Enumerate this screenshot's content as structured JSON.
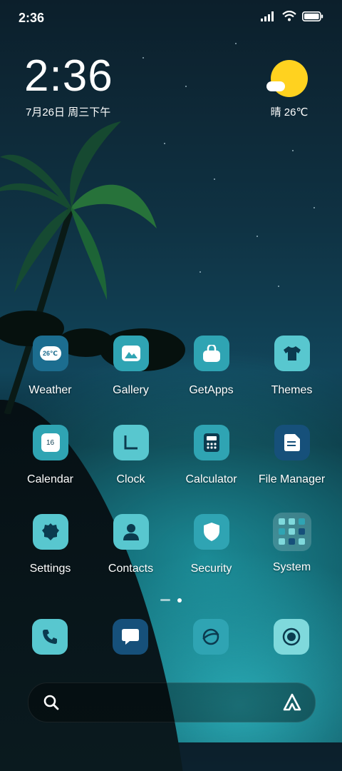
{
  "status_bar": {
    "time": "2:36",
    "signal_icon": "signal-bars-icon",
    "wifi_icon": "wifi-icon",
    "battery_icon": "battery-icon"
  },
  "clock_widget": {
    "time": "2:36",
    "date": "7月26日 周三下午"
  },
  "weather_widget": {
    "condition": "晴",
    "temperature": "26℃",
    "icon": "sun-icon",
    "summary": "晴 26℃"
  },
  "apps": [
    {
      "label": "Weather",
      "icon": "weather-icon",
      "icon_text": "26℃",
      "color": "#1c6d8f"
    },
    {
      "label": "Gallery",
      "icon": "gallery-icon",
      "color": "#2fa4b3"
    },
    {
      "label": "GetApps",
      "icon": "shopping-bag-icon",
      "color": "#2fa4b3"
    },
    {
      "label": "Themes",
      "icon": "tshirt-icon",
      "color": "#58c7cf"
    },
    {
      "label": "Calendar",
      "icon": "calendar-icon",
      "icon_text": "16",
      "color": "#2fa4b3"
    },
    {
      "label": "Clock",
      "icon": "clock-icon",
      "color": "#58c7cf"
    },
    {
      "label": "Calculator",
      "icon": "calculator-icon",
      "color": "#2fa4b3"
    },
    {
      "label": "File Manager",
      "icon": "file-manager-icon",
      "color": "#16507a"
    },
    {
      "label": "Settings",
      "icon": "settings-icon",
      "color": "#58c7cf"
    },
    {
      "label": "Contacts",
      "icon": "contacts-icon",
      "color": "#58c7cf"
    },
    {
      "label": "Security",
      "icon": "shield-icon",
      "color": "#2fa4b3"
    },
    {
      "label": "System",
      "icon": "folder-icon",
      "color": "rgba(255,255,255,0.18)"
    }
  ],
  "page_indicator": {
    "pages": 2,
    "current": 2
  },
  "dock": [
    {
      "name": "phone",
      "icon": "phone-icon",
      "color": "#58c7cf"
    },
    {
      "name": "messages",
      "icon": "message-icon",
      "color": "#16507a"
    },
    {
      "name": "browser",
      "icon": "browser-icon",
      "color": "#2fa4b3"
    },
    {
      "name": "camera",
      "icon": "camera-icon",
      "color": "#7fd9dc"
    }
  ],
  "search_bar": {
    "search_icon": "search-icon",
    "assistant_icon": "assistant-icon"
  }
}
